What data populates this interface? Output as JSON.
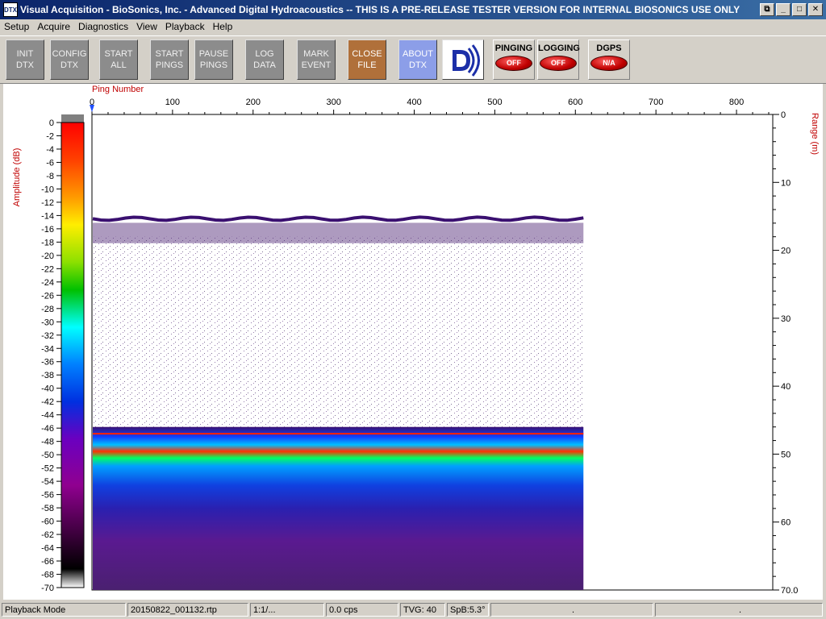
{
  "window": {
    "icon_text": "DTX",
    "title": "Visual Acquisition  -  BioSonics, Inc.  -  Advanced Digital Hydroacoustics  -- THIS IS A PRE-RELEASE TESTER VERSION FOR INTERNAL BIOSONICS USE ONLY",
    "controls": [
      "⧉",
      "_",
      "□",
      "✕"
    ]
  },
  "menu": [
    "Setup",
    "Acquire",
    "Diagnostics",
    "View",
    "Playback",
    "Help"
  ],
  "toolbar": {
    "buttons": [
      {
        "id": "init-dtx",
        "label": "INIT\nDTX"
      },
      {
        "id": "config-dtx",
        "label": "CONFIG\nDTX"
      },
      {
        "id": "start-all",
        "label": "START\nALL"
      },
      {
        "id": "start-pings",
        "label": "START\nPINGS"
      },
      {
        "id": "pause-pings",
        "label": "PAUSE\nPINGS"
      },
      {
        "id": "log-data",
        "label": "LOG\nDATA"
      },
      {
        "id": "mark-event",
        "label": "MARK\nEVENT"
      },
      {
        "id": "close-file",
        "label": "CLOSE\nFILE"
      },
      {
        "id": "about-dtx",
        "label": "ABOUT\nDTX"
      }
    ],
    "status": [
      {
        "id": "pinging",
        "label": "PINGING",
        "value": "OFF"
      },
      {
        "id": "logging",
        "label": "LOGGING",
        "value": "OFF"
      },
      {
        "id": "dgps",
        "label": "DGPS",
        "value": "N/A"
      }
    ]
  },
  "chart_data": {
    "type": "heatmap",
    "title": "",
    "xlabel": "Ping Number",
    "ylabel": "Range (m)",
    "colorbar_label": "Amplitude (dB)",
    "x_ticks": [
      0,
      100,
      200,
      300,
      400,
      500,
      600,
      700,
      800
    ],
    "xlim": [
      0,
      845
    ],
    "y_ticks": [
      0,
      10,
      20,
      30,
      40,
      50,
      60,
      70
    ],
    "y_tick_labels": [
      "0",
      "10",
      "20",
      "30",
      "40",
      "50",
      "60",
      "70.0"
    ],
    "ylim": [
      0,
      70
    ],
    "colorbar_ticks": [
      0,
      -2,
      -4,
      -6,
      -8,
      -10,
      -12,
      -14,
      -16,
      -18,
      -20,
      -22,
      -24,
      -26,
      -28,
      -30,
      -32,
      -34,
      -36,
      -38,
      -40,
      -42,
      -44,
      -46,
      -48,
      -50,
      -52,
      -54,
      -56,
      -58,
      -60,
      -62,
      -64,
      -66,
      -68,
      -70
    ],
    "colorbar_range": [
      -70,
      0
    ],
    "data_pings": [
      0,
      610
    ],
    "surface_layer_range_m": [
      15,
      18
    ],
    "bottom_range_m": 47,
    "bottom_layer_range_m": [
      46,
      70
    ]
  },
  "statusbar": [
    "Playback Mode",
    "20150822_001132.rtp",
    "1:1/...",
    "0.0 cps",
    "TVG: 40",
    "SpB:5.3°",
    ".",
    "."
  ]
}
